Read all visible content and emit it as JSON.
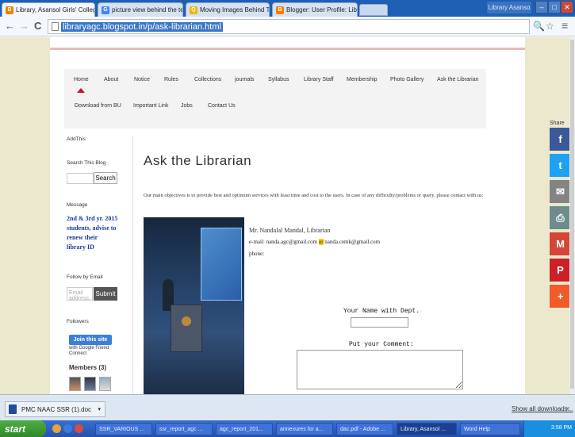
{
  "browser": {
    "tabs": [
      {
        "title": "Library, Asansol Girls' College",
        "favicon_color": "#f57d00",
        "favicon": "B"
      },
      {
        "title": "picture view behind the text",
        "favicon_color": "#4285f4",
        "favicon": "G"
      },
      {
        "title": "Moving Images Behind Text",
        "favicon_color": "#f4b400",
        "favicon": "Q"
      },
      {
        "title": "Blogger: User Profile: Library",
        "favicon_color": "#f57d00",
        "favicon": "B"
      }
    ],
    "tab_close": "×",
    "profile": "Library Asanso",
    "window_buttons": [
      "–",
      "□",
      "✕"
    ],
    "nav": {
      "back": "←",
      "forward": "→",
      "reload": "C"
    },
    "url": "libraryagc.blogspot.in/p/ask-librarian.html",
    "toolbar_icons": [
      "🔍",
      "☆",
      "≡"
    ]
  },
  "nav_menu": {
    "row1": [
      "Home",
      "About",
      "Notice",
      "Rules",
      "Collections",
      "journals",
      "Syllabus",
      "Library Staff",
      "Membership",
      "Photo Gallery",
      "Ask the Librarian"
    ],
    "row2": [
      "Download from BU",
      "Important Link",
      "Jobs",
      "Contact Us"
    ]
  },
  "sidebar": {
    "addthis": "AddThis",
    "search_title": "Search This Blog",
    "search_button": "Search",
    "message_title": "Message",
    "message_text": "2nd & 3rd yr. 2015 students, advise to renew their library ID",
    "follow_title": "Follow by Email",
    "email_placeholder": "Email address...",
    "submit_button": "Submit",
    "followers_title": "Followers",
    "join_button": "Join this site",
    "join_sub": "with Google Friend Connect",
    "members": "Members (3)"
  },
  "main": {
    "title": "Ask the Librarian",
    "objective": "Our main objectives is to provide best and optimum services with least time and cost to the users.  In case of any difficulty/problems or query,   please contact with us:",
    "contact_name": "Mr. Nandalal Mandal, Librarian",
    "email_prefix": "e-mail: nanda.agc@gmail.com",
    "email_or": "or",
    "email_alt": "nanda.cemk@gmail.com",
    "phone": "phone:",
    "form_label1": "Your Name with Dept.",
    "form_label2": "Put your Comment:"
  },
  "share": {
    "title": "Share",
    "buttons": [
      {
        "icon": "f",
        "color": "#3b5998"
      },
      {
        "icon": "t",
        "color": "#1da1f2"
      },
      {
        "icon": "✉",
        "color": "#848484"
      },
      {
        "icon": "⎙",
        "color": "#6d8c8c"
      },
      {
        "icon": "M",
        "color": "#d44638"
      },
      {
        "icon": "P",
        "color": "#cb2027"
      },
      {
        "icon": "+",
        "color": "#f15a29"
      }
    ]
  },
  "downloads": {
    "file": "PMC NAAC SSR (1).doc",
    "show_all": "Show all downloads...",
    "close": "×"
  },
  "taskbar": {
    "start": "start",
    "items": [
      "SSR_VARIOUS ...",
      "ssr_report_agc ...",
      "agc_report_201...",
      "annexures for a...",
      "dac.pdf - Adobe ...",
      "Library, Asansol ...",
      "Word Help"
    ],
    "clock": "3:58 PM"
  }
}
